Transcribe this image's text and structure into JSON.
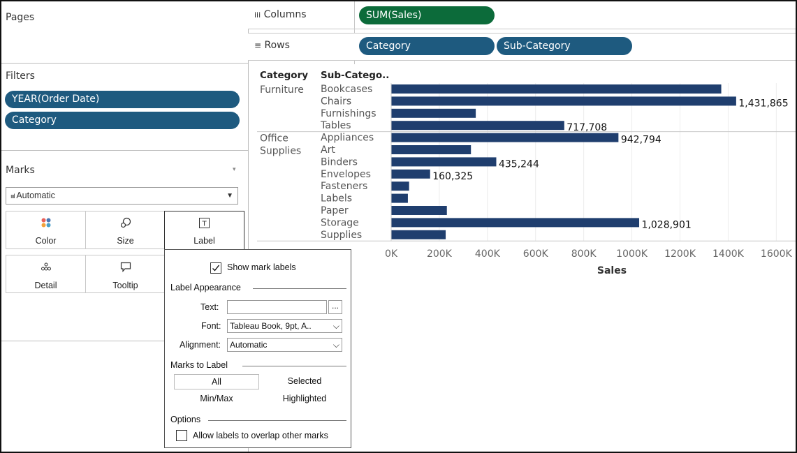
{
  "pages": {
    "title": "Pages"
  },
  "filters": {
    "title": "Filters",
    "items": [
      "YEAR(Order Date)",
      "Category"
    ]
  },
  "marks": {
    "title": "Marks",
    "mark_type": "Automatic",
    "cards": [
      {
        "label": "Color",
        "icon": "color-dots-icon"
      },
      {
        "label": "Size",
        "icon": "size-icon"
      },
      {
        "label": "Label",
        "icon": "text-label-icon"
      },
      {
        "label": "Detail",
        "icon": "detail-dots-icon"
      },
      {
        "label": "Tooltip",
        "icon": "tooltip-icon"
      }
    ]
  },
  "shelves": {
    "columns_label": "Columns",
    "rows_label": "Rows",
    "columns_pills": [
      "SUM(Sales)"
    ],
    "rows_pills": [
      "Category",
      "Sub-Category"
    ]
  },
  "label_popup": {
    "show_mark_labels": "Show mark labels",
    "show_mark_labels_checked": true,
    "label_appearance": "Label Appearance",
    "text_label": "Text:",
    "text_value": "",
    "text_button": "...",
    "font_label": "Font:",
    "font_value": "Tableau Book, 9pt, A..",
    "alignment_label": "Alignment:",
    "alignment_value": "Automatic",
    "marks_to_label": "Marks to Label",
    "opt_all": "All",
    "opt_selected": "Selected",
    "opt_minmax": "Min/Max",
    "opt_highlighted": "Highlighted",
    "options": "Options",
    "allow_overlap": "Allow labels to overlap other marks",
    "allow_overlap_checked": false
  },
  "colors": {
    "bar": "#1f3e6e",
    "pill_blue": "#1e5a7f",
    "pill_green": "#0c6b3a"
  },
  "chart_data": {
    "type": "bar",
    "orientation": "horizontal",
    "header_category": "Category",
    "header_subcategory": "Sub-Catego..",
    "groups": [
      {
        "category": [
          "Furniture"
        ],
        "rows": [
          {
            "name": "Bookcases",
            "value": 1370000,
            "label": ""
          },
          {
            "name": "Chairs",
            "value": 1431865,
            "label": "1,431,865"
          },
          {
            "name": "Furnishings",
            "value": 350000,
            "label": ""
          },
          {
            "name": "Tables",
            "value": 717708,
            "label": "717,708"
          }
        ]
      },
      {
        "category": [
          "Office",
          "Supplies"
        ],
        "rows": [
          {
            "name": "Appliances",
            "value": 942794,
            "label": "942,794"
          },
          {
            "name": "Art",
            "value": 330000,
            "label": ""
          },
          {
            "name": "Binders",
            "value": 435244,
            "label": "435,244"
          },
          {
            "name": "Envelopes",
            "value": 160325,
            "label": "160,325"
          },
          {
            "name": "Fasteners",
            "value": 73000,
            "label": ""
          },
          {
            "name": "Labels",
            "value": 68000,
            "label": ""
          },
          {
            "name": "Paper",
            "value": 230000,
            "label": ""
          },
          {
            "name": "Storage",
            "value": 1028901,
            "label": "1,028,901"
          },
          {
            "name": "Supplies",
            "value": 225000,
            "label": ""
          }
        ]
      }
    ],
    "x_ticks": [
      "0K",
      "200K",
      "400K",
      "600K",
      "800K",
      "1000K",
      "1200K",
      "1400K",
      "1600K"
    ],
    "x_tick_values": [
      0,
      200000,
      400000,
      600000,
      800000,
      1000000,
      1200000,
      1400000,
      1600000
    ],
    "xlabel": "Sales",
    "xlim": [
      0,
      1660000
    ],
    "grid": true
  }
}
